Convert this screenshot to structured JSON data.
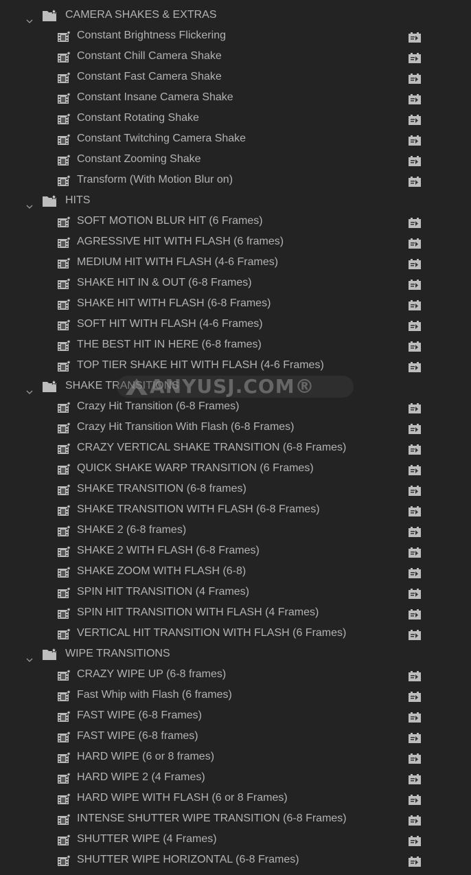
{
  "colors": {
    "background": "#232323",
    "text": "#b3b3b3",
    "icon": "#bdbdbd"
  },
  "watermark": "ANYUSJ.COM®",
  "folders": [
    {
      "label": "CAMERA SHAKES & EXTRAS",
      "expanded": true,
      "items": [
        "Constant Brightness Flickering",
        "Constant Chill Camera Shake",
        "Constant Fast Camera Shake",
        "Constant Insane Camera Shake",
        "Constant Rotating Shake",
        "Constant Twitching Camera Shake",
        "Constant Zooming Shake",
        "Transform (With Motion Blur on)"
      ]
    },
    {
      "label": "HITS",
      "expanded": true,
      "items": [
        "SOFT MOTION BLUR HIT (6 Frames)",
        "AGRESSIVE HIT WITH FLASH (6 frames)",
        "MEDIUM HIT WITH FLASH (4-6 Frames)",
        "SHAKE HIT IN & OUT (6-8 Frames)",
        "SHAKE HIT WITH FLASH (6-8 Frames)",
        "SOFT HIT WITH FLASH (4-6 Frames)",
        "THE BEST HIT IN HERE (6-8 frames)",
        "TOP TIER SHAKE HIT WITH FLASH (4-6 Frames)"
      ]
    },
    {
      "label": "SHAKE TRANSITIONS",
      "expanded": true,
      "items": [
        "Crazy Hit Transition (6-8 Frames)",
        "Crazy Hit Transition With Flash (6-8 Frames)",
        "CRAZY VERTICAL SHAKE TRANSITION (6-8 Frames)",
        "QUICK SHAKE WARP TRANSITION (6 Frames)",
        "SHAKE TRANSITION (6-8 frames)",
        "SHAKE TRANSITION WITH FLASH (6-8 Frames)",
        "SHAKE 2 (6-8 frames)",
        "SHAKE 2 WITH FLASH (6-8 Frames)",
        "SHAKE ZOOM WITH FLASH (6-8)",
        "SPIN HIT TRANSITION (4 Frames)",
        "SPIN HIT TRANSITION WITH FLASH (4 Frames)",
        "VERTICAL HIT TRANSITION WITH FLASH (6 Frames)"
      ]
    },
    {
      "label": "WIPE TRANSITIONS",
      "expanded": true,
      "items": [
        "CRAZY WIPE UP (6-8 frames)",
        "Fast Whip with Flash (6 frames)",
        "FAST WIPE (6-8 Frames)",
        "FAST WIPE (6-8 frames)",
        "HARD WIPE (6 or 8 frames)",
        "HARD WIPE 2 (4 Frames)",
        "HARD WIPE WITH FLASH (6 or 8 Frames)",
        "INTENSE SHUTTER WIPE TRANSITION (6-8 Frames)",
        "SHUTTER WIPE (4 Frames)",
        "SHUTTER WIPE HORIZONTAL (6-8 Frames)"
      ]
    }
  ]
}
